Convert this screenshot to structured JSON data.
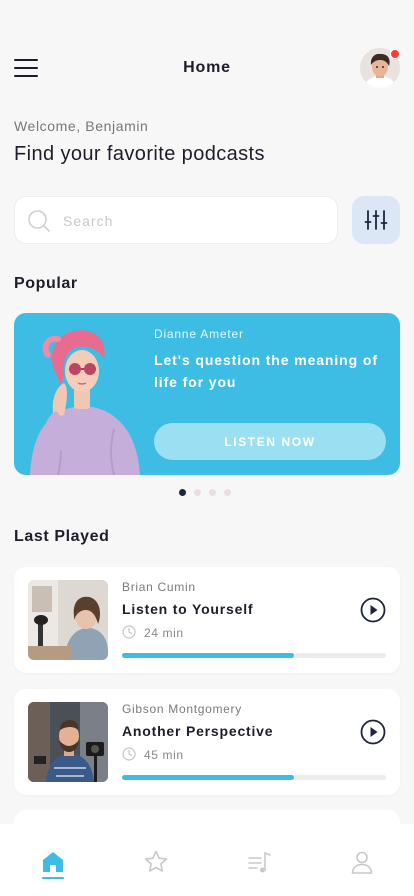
{
  "header": {
    "title": "Home",
    "menu_icon": "hamburger-menu-icon",
    "has_notification": true
  },
  "welcome": {
    "greeting": "Welcome, Benjamin",
    "title": "Find your favorite podcasts"
  },
  "search": {
    "placeholder": "Search",
    "value": ""
  },
  "popular": {
    "section_title": "Popular",
    "featured": {
      "author": "Dianne Ameter",
      "text": "Let's question the meaning of life for you",
      "button_label": "LISTEN NOW"
    },
    "carousel_pages": 4,
    "active_page": 1
  },
  "last_played": {
    "section_title": "Last Played",
    "items": [
      {
        "author": "Brian Cumin",
        "title": "Listen to Yourself",
        "duration": "24 min",
        "progress": 0.65
      },
      {
        "author": "Gibson Montgomery",
        "title": "Another Perspective",
        "duration": "45 min",
        "progress": 0.65
      }
    ]
  },
  "bottom_nav": {
    "items": [
      "home",
      "favorites",
      "playlist",
      "profile"
    ],
    "active": "home"
  },
  "colors": {
    "accent": "#3ebde4",
    "dark": "#1e1e2a",
    "filter_bg": "#dbe7f5",
    "notification": "#ff3b30"
  }
}
